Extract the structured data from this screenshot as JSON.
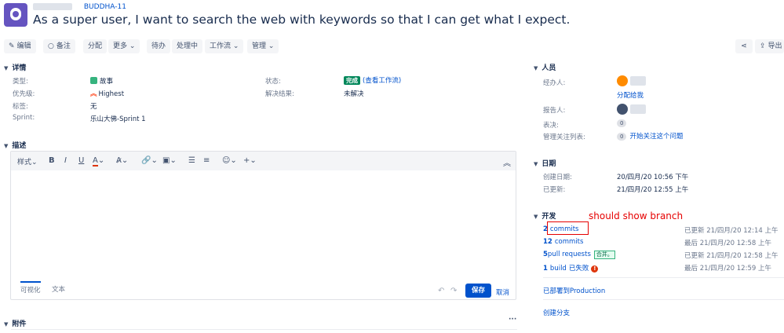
{
  "header": {
    "breadcrumb_key": "BUDDHA-11",
    "title": "As a super user, I want to search the web with keywords so that I can get what I expect."
  },
  "toolbar": {
    "edit": "编辑",
    "comment": "备注",
    "assign": "分配",
    "more": "更多",
    "todo": "待办",
    "in_progress": "处理中",
    "workflow": "工作流",
    "admin": "管理",
    "export": "导出"
  },
  "details": {
    "heading": "详情",
    "type_label": "类型:",
    "type_value": "故事",
    "priority_label": "优先级:",
    "priority_value": "Highest",
    "labels_label": "标签:",
    "labels_value": "无",
    "sprint_label": "Sprint:",
    "sprint_value": "乐山大佛-Sprint 1",
    "status_label": "状态:",
    "status_badge": "完成",
    "status_link": "(查看工作流)",
    "resolution_label": "解决结果:",
    "resolution_value": "未解决"
  },
  "description": {
    "heading": "描述",
    "style_menu": "样式",
    "tab_visual": "可视化",
    "tab_text": "文本",
    "save": "保存",
    "cancel": "取消"
  },
  "attachments": {
    "heading": "附件"
  },
  "people": {
    "heading": "人员",
    "assignee_label": "经办人:",
    "assign_to_me": "分配给我",
    "reporter_label": "报告人:",
    "votes_label": "表决:",
    "votes_count": "0",
    "watchers_label": "管理关注列表:",
    "watchers_count": "0",
    "watch_link": "开始关注这个问题"
  },
  "dates": {
    "heading": "日期",
    "created_label": "创建日期:",
    "created_value": "20/四月/20 10:56 下午",
    "updated_label": "已更新:",
    "updated_value": "21/四月/20 12:55 上午"
  },
  "development": {
    "heading": "开发",
    "annotation": "should show branch",
    "rows": [
      {
        "count": "2",
        "label": "commits",
        "extra": "",
        "time": "已更新 21/四月/20 12:14 上午"
      },
      {
        "count": "12",
        "label": "commits",
        "extra": "",
        "time": "最后 21/四月/20 12:58 上午"
      },
      {
        "count": "5",
        "label": "pull requests",
        "extra": "合并。",
        "time": "已更新 21/四月/20 12:58 上午"
      },
      {
        "count": "1",
        "label": "build",
        "extra": "已失败",
        "time": "最后 21/四月/20 12:59 上午"
      }
    ],
    "deployed": "已部署到Production",
    "create_branch": "创建分支"
  },
  "colors": {
    "link": "#0052cc",
    "story_green": "#36b37e",
    "done_green": "#00875a",
    "priority_red": "#ff5630",
    "save_blue": "#0052cc",
    "annotation_red": "#e60000"
  }
}
